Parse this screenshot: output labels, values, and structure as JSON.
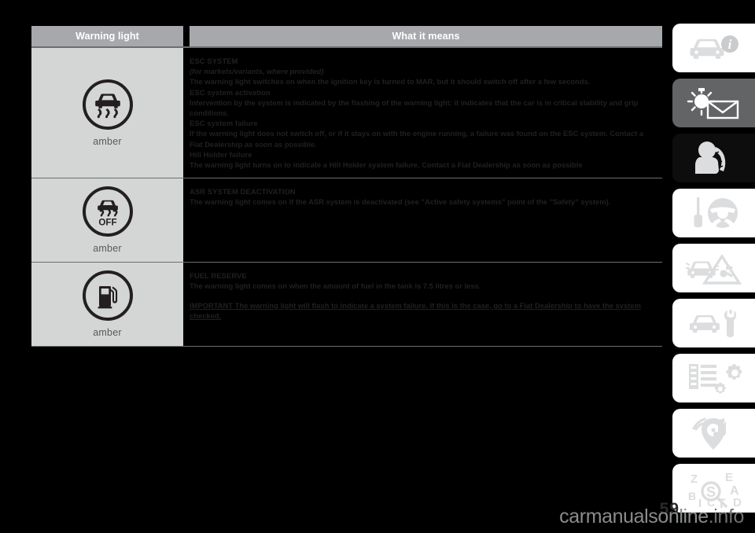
{
  "table": {
    "headers": {
      "left": "Warning light",
      "right": "What it means"
    },
    "rows": [
      {
        "icon_name": "esc-skid-warning-light",
        "colour_label": "amber",
        "blocks": [
          {
            "style": "heading",
            "text": "ESC SYSTEM"
          },
          {
            "style": "italic",
            "text": "(for markets/variants, where provided)"
          },
          {
            "style": "body",
            "text": "The warning light switches on when the ignition key is turned to MAR, but it should switch off after a few seconds."
          },
          {
            "style": "subhead",
            "text": "ESC system activation"
          },
          {
            "style": "body",
            "text": "Intervention by the system is indicated by the flashing of the warning light: it indicates that the car is in critical stability and grip conditions."
          },
          {
            "style": "subhead",
            "text": "ESC system failure"
          },
          {
            "style": "body",
            "text": "If the warning light does not switch off, or if it stays on with the engine running, a failure was found on the ESC system. Contact a Fiat Dealership as soon as possible."
          },
          {
            "style": "subhead",
            "text": "Hill Holder failure"
          },
          {
            "style": "body",
            "text": "The warning light turns on to indicate a Hill Holder system failure. Contact a Fiat Dealership as soon as possible"
          }
        ]
      },
      {
        "icon_name": "asr-off-warning-light",
        "colour_label": "amber",
        "blocks": [
          {
            "style": "heading",
            "text": "ASR SYSTEM DEACTIVATION"
          },
          {
            "style": "body",
            "text": "The warning light comes on if the ASR system is deactivated (see \"Active safety systems\" point of the \"Safety\" system)."
          }
        ]
      },
      {
        "icon_name": "fuel-reserve-warning-light",
        "colour_label": "amber",
        "blocks": [
          {
            "style": "heading",
            "text": "FUEL RESERVE"
          },
          {
            "style": "body",
            "text": "The warning light comes on when the amount of fuel in the tank is 7.5 litres or less."
          },
          {
            "style": "important",
            "text": "IMPORTANT The warning light will flash to indicate a system failure. If this is the case, go to a Fiat Dealership to have the system checked."
          }
        ]
      }
    ]
  },
  "side_tabs": [
    {
      "icon": "car-info-icon",
      "theme": "white"
    },
    {
      "icon": "sun-envelope-icon",
      "theme": "grey"
    },
    {
      "icon": "airbag-seatbelt-icon",
      "theme": "black"
    },
    {
      "icon": "key-steering-wheel-icon",
      "theme": "white"
    },
    {
      "icon": "car-warning-triangle-icon",
      "theme": "white"
    },
    {
      "icon": "car-wrench-icon",
      "theme": "white"
    },
    {
      "icon": "list-gears-icon",
      "theme": "white"
    },
    {
      "icon": "radio-music-icon",
      "theme": "white"
    },
    {
      "icon": "alphabetical-index-icon",
      "theme": "white"
    }
  ],
  "footer": {
    "page_number": "59",
    "watermark": "carmanualsonline",
    "watermark_suffix": ".info"
  },
  "colors": {
    "header_bar": "#a6a8ab",
    "icon_cell": "#d4d6d6",
    "rule": "#6d6e71",
    "ink": "#231f20"
  }
}
